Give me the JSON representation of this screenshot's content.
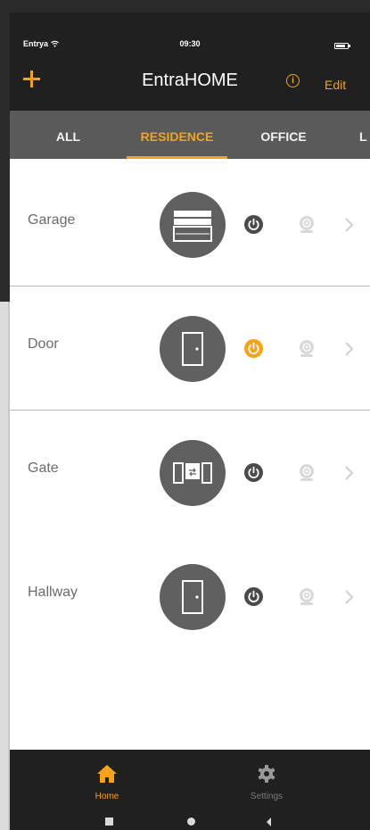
{
  "status_bar": {
    "carrier": "Entrya",
    "time": "09:30"
  },
  "header": {
    "title": "EntraHOME",
    "edit_label": "Edit",
    "info_icon": "info-icon",
    "add_icon": "plus-icon"
  },
  "tabs": [
    {
      "label": "ALL",
      "active": false
    },
    {
      "label": "RESIDENCE",
      "active": true
    },
    {
      "label": "OFFICE",
      "active": false
    },
    {
      "label": "L",
      "active": false
    }
  ],
  "devices": [
    {
      "name": "Garage",
      "icon": "garage-door-icon",
      "power": "off"
    },
    {
      "name": "Door",
      "icon": "door-icon",
      "power": "on"
    },
    {
      "name": "Gate",
      "icon": "gate-icon",
      "power": "off"
    },
    {
      "name": "Hallway",
      "icon": "door-icon",
      "power": "off"
    }
  ],
  "bottom_nav": [
    {
      "label": "Home",
      "icon": "home-icon",
      "active": true
    },
    {
      "label": "Settings",
      "icon": "gear-icon",
      "active": false
    }
  ],
  "colors": {
    "accent": "#f7a21b",
    "header_bg": "#202020",
    "tab_bg": "#5a5a5a",
    "device_bg": "#606060"
  }
}
